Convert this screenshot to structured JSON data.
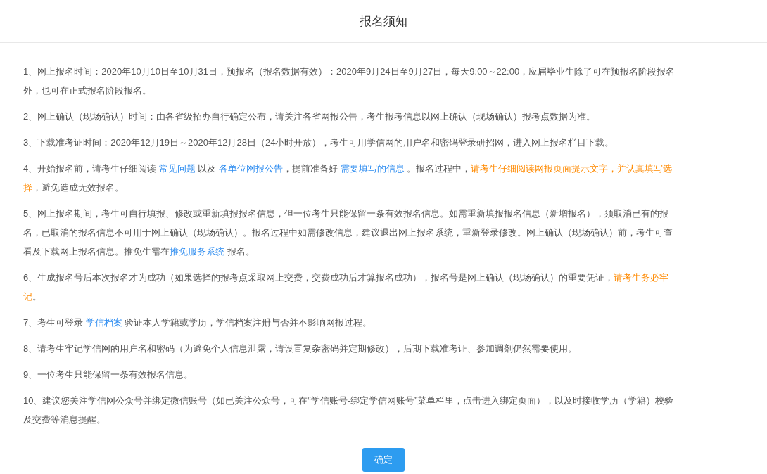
{
  "dialog": {
    "title": "报名须知",
    "paragraphs": [
      [
        {
          "kind": "text",
          "text": "1、网上报名时间：2020年10月10日至10月31日，预报名（报名数据有效）：2020年9月24日至9月27日，每天9:00～22:00，应届毕业生除了可在预报名阶段报名外，也可在正式报名阶段报名。"
        }
      ],
      [
        {
          "kind": "text",
          "text": "2、网上确认（现场确认）时间：由各省级招办自行确定公布，请关注各省网报公告，考生报考信息以网上确认（现场确认）报考点数据为准。"
        }
      ],
      [
        {
          "kind": "text",
          "text": "3、下载准考证时间：2020年12月19日～2020年12月28日（24小时开放），考生可用学信网的用户名和密码登录研招网，进入网上报名栏目下载。"
        }
      ],
      [
        {
          "kind": "text",
          "text": "4、开始报名前，请考生仔细阅读 "
        },
        {
          "kind": "link",
          "text": "常见问题"
        },
        {
          "kind": "text",
          "text": " 以及 "
        },
        {
          "kind": "link",
          "text": "各单位网报公告"
        },
        {
          "kind": "text",
          "text": "，提前准备好 "
        },
        {
          "kind": "link",
          "text": "需要填写的信息"
        },
        {
          "kind": "text",
          "text": " 。报名过程中，"
        },
        {
          "kind": "warning",
          "text": "请考生仔细阅读网报页面提示文字，并认真填写选择"
        },
        {
          "kind": "text",
          "text": "，避免造成无效报名。"
        }
      ],
      [
        {
          "kind": "text",
          "text": "5、网上报名期间，考生可自行填报、修改或重新填报报名信息，但一位考生只能保留一条有效报名信息。如需重新填报报名信息（新增报名），须取消已有的报名，已取消的报名信息不可用于网上确认（现场确认）。报名过程中如需修改信息，建议退出网上报名系统，重新登录修改。网上确认（现场确认）前，考生可查看及下载网上报名信息。推免生需在"
        },
        {
          "kind": "link",
          "text": "推免服务系统"
        },
        {
          "kind": "text",
          "text": " 报名。"
        }
      ],
      [
        {
          "kind": "text",
          "text": "6、生成报名号后本次报名才为成功（如果选择的报考点采取网上交费，交费成功后才算报名成功），报名号是网上确认（现场确认）的重要凭证，"
        },
        {
          "kind": "warning",
          "text": "请考生务必牢记"
        },
        {
          "kind": "text",
          "text": "。"
        }
      ],
      [
        {
          "kind": "text",
          "text": "7、考生可登录 "
        },
        {
          "kind": "link",
          "text": "学信档案"
        },
        {
          "kind": "text",
          "text": " 验证本人学籍或学历，学信档案注册与否并不影响网报过程。"
        }
      ],
      [
        {
          "kind": "text",
          "text": "8、请考生牢记学信网的用户名和密码（为避免个人信息泄露，请设置复杂密码并定期修改），后期下载准考证、参加调剂仍然需要使用。"
        }
      ],
      [
        {
          "kind": "text",
          "text": "9、一位考生只能保留一条有效报名信息。"
        }
      ],
      [
        {
          "kind": "text",
          "text": "10、建议您关注学信网公众号并绑定微信账号（如已关注公众号，可在“学信账号-绑定学信网账号”菜单栏里，点击进入绑定页面），以及时接收学历（学籍）校验及交费等消息提醒。"
        }
      ]
    ],
    "confirm_button": "确定"
  }
}
